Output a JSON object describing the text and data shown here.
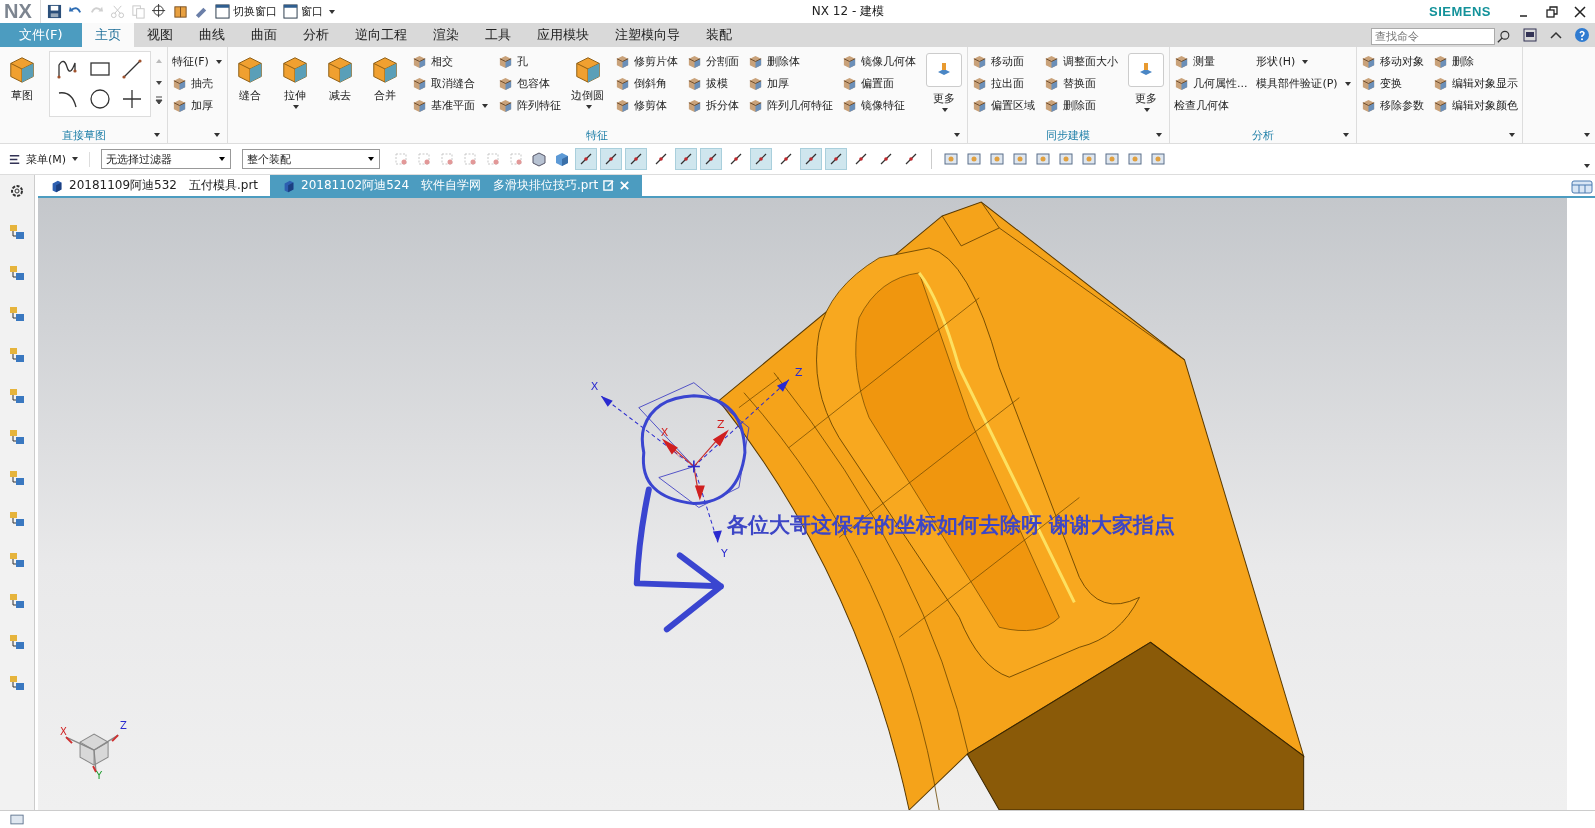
{
  "title_bar": {
    "app": "NX",
    "title": "NX 12 - 建模",
    "brand": "SIEMENS",
    "quick_access": [
      {
        "label": "切换窗口"
      },
      {
        "label": "窗口",
        "dropdown": true
      }
    ]
  },
  "menu_tabs": [
    {
      "label": "文件(F)",
      "kind": "file",
      "selected": false
    },
    {
      "label": "主页",
      "kind": "tab",
      "selected": true
    },
    {
      "label": "视图",
      "kind": "tab",
      "selected": false
    },
    {
      "label": "曲线",
      "kind": "tab",
      "selected": false
    },
    {
      "label": "曲面",
      "kind": "tab",
      "selected": false
    },
    {
      "label": "分析",
      "kind": "tab",
      "selected": false
    },
    {
      "label": "逆向工程",
      "kind": "tab",
      "selected": false
    },
    {
      "label": "渲染",
      "kind": "tab",
      "selected": false
    },
    {
      "label": "工具",
      "kind": "tab",
      "selected": false
    },
    {
      "label": "应用模块",
      "kind": "tab",
      "selected": false
    },
    {
      "label": "注塑模向导",
      "kind": "tab",
      "selected": false
    },
    {
      "label": "装配",
      "kind": "tab",
      "selected": false
    }
  ],
  "search": {
    "placeholder": "查找命令"
  },
  "ribbon": [
    {
      "title": "直接草图",
      "columns": [
        {
          "kind": "big",
          "items": [
            {
              "label": "草图"
            }
          ]
        },
        {
          "kind": "sketch_gallery"
        }
      ]
    },
    {
      "columns": [
        {
          "kind": "small",
          "items": [
            {
              "label": "特征(F)",
              "icon": false,
              "dropdown": true
            },
            {
              "label": "抽壳"
            },
            {
              "label": "加厚"
            }
          ]
        }
      ]
    },
    {
      "title": "特征",
      "columns": [
        {
          "kind": "big",
          "items": [
            {
              "label": "缝合"
            }
          ]
        },
        {
          "kind": "big",
          "items": [
            {
              "label": "拉伸",
              "dropdown": true
            }
          ]
        },
        {
          "kind": "big",
          "items": [
            {
              "label": "减去"
            }
          ]
        },
        {
          "kind": "big",
          "items": [
            {
              "label": "合并"
            }
          ]
        },
        {
          "kind": "small",
          "items": [
            {
              "label": "相交"
            },
            {
              "label": "取消缝合"
            },
            {
              "label": "基准平面",
              "dropdown": true
            }
          ]
        },
        {
          "kind": "small",
          "items": [
            {
              "label": "孔"
            },
            {
              "label": "包容体"
            },
            {
              "label": "阵列特征"
            }
          ]
        },
        {
          "kind": "big",
          "items": [
            {
              "label": "边倒圆",
              "dropdown": true
            }
          ]
        },
        {
          "kind": "small",
          "items": [
            {
              "label": "修剪片体"
            },
            {
              "label": "倒斜角"
            },
            {
              "label": "修剪体"
            }
          ]
        },
        {
          "kind": "small",
          "items": [
            {
              "label": "分割面"
            },
            {
              "label": "拔模"
            },
            {
              "label": "拆分体"
            }
          ]
        },
        {
          "kind": "small",
          "items": [
            {
              "label": "删除体"
            },
            {
              "label": "加厚"
            },
            {
              "label": "阵列几何特征"
            }
          ]
        },
        {
          "kind": "small",
          "items": [
            {
              "label": "镜像几何体"
            },
            {
              "label": "偏置面"
            },
            {
              "label": "镜像特征"
            }
          ]
        },
        {
          "kind": "more",
          "items": [
            {
              "label": "更多",
              "dropdown": true
            }
          ]
        }
      ]
    },
    {
      "title": "同步建模",
      "columns": [
        {
          "kind": "small",
          "items": [
            {
              "label": "移动面"
            },
            {
              "label": "拉出面"
            },
            {
              "label": "偏置区域"
            }
          ]
        },
        {
          "kind": "small",
          "items": [
            {
              "label": "调整面大小"
            },
            {
              "label": "替换面"
            },
            {
              "label": "删除面"
            }
          ]
        },
        {
          "kind": "more",
          "items": [
            {
              "label": "更多",
              "dropdown": true
            }
          ]
        }
      ]
    },
    {
      "title": "分析",
      "columns": [
        {
          "kind": "small",
          "items": [
            {
              "label": "测量"
            },
            {
              "label": "几何属性..."
            },
            {
              "label": "检查几何体",
              "icon": false
            }
          ]
        },
        {
          "kind": "small",
          "items": [
            {
              "label": "形状(H)",
              "icon": false,
              "dropdown": true
            },
            {
              "label": "模具部件验证(P)",
              "icon": false,
              "dropdown": true
            }
          ]
        }
      ]
    },
    {
      "columns": [
        {
          "kind": "small",
          "items": [
            {
              "label": "移动对象"
            },
            {
              "label": "变换"
            },
            {
              "label": "移除参数"
            }
          ]
        },
        {
          "kind": "small",
          "items": [
            {
              "label": "删除"
            },
            {
              "label": "编辑对象显示"
            },
            {
              "label": "编辑对象颜色"
            }
          ]
        }
      ]
    }
  ],
  "toolbar": {
    "menu": "菜单(M)",
    "filters": [
      {
        "value": "无选择过滤器"
      },
      {
        "value": "整个装配"
      }
    ],
    "snap_buttons": [
      {
        "on": true
      },
      {
        "on": true
      },
      {
        "on": true
      },
      {
        "on": false
      },
      {
        "on": true
      },
      {
        "on": true
      },
      {
        "on": false
      },
      {
        "on": true
      },
      {
        "on": false
      },
      {
        "on": true
      },
      {
        "on": true
      },
      {
        "on": false
      },
      {
        "on": false
      },
      {
        "on": false
      }
    ]
  },
  "doc_tabs": [
    {
      "label": "20181109阿迪532　五付模具.prt",
      "selected": false
    },
    {
      "label": "20181102阿迪524　软件自学网　多滑块排位技巧.prt",
      "selected": true
    }
  ],
  "viewport": {
    "annotation": "各位大哥这保存的坐标如何去除呀 谢谢大家指点",
    "axis_labels": [
      {
        "text": "X",
        "kind": "datum"
      },
      {
        "text": "Z",
        "kind": "datum"
      },
      {
        "text": "Y",
        "kind": "datum"
      },
      {
        "text": "X",
        "kind": "wcs"
      },
      {
        "text": "Z",
        "kind": "wcs"
      }
    ],
    "view_triad_labels": [
      "X",
      "Z",
      "Y"
    ]
  }
}
